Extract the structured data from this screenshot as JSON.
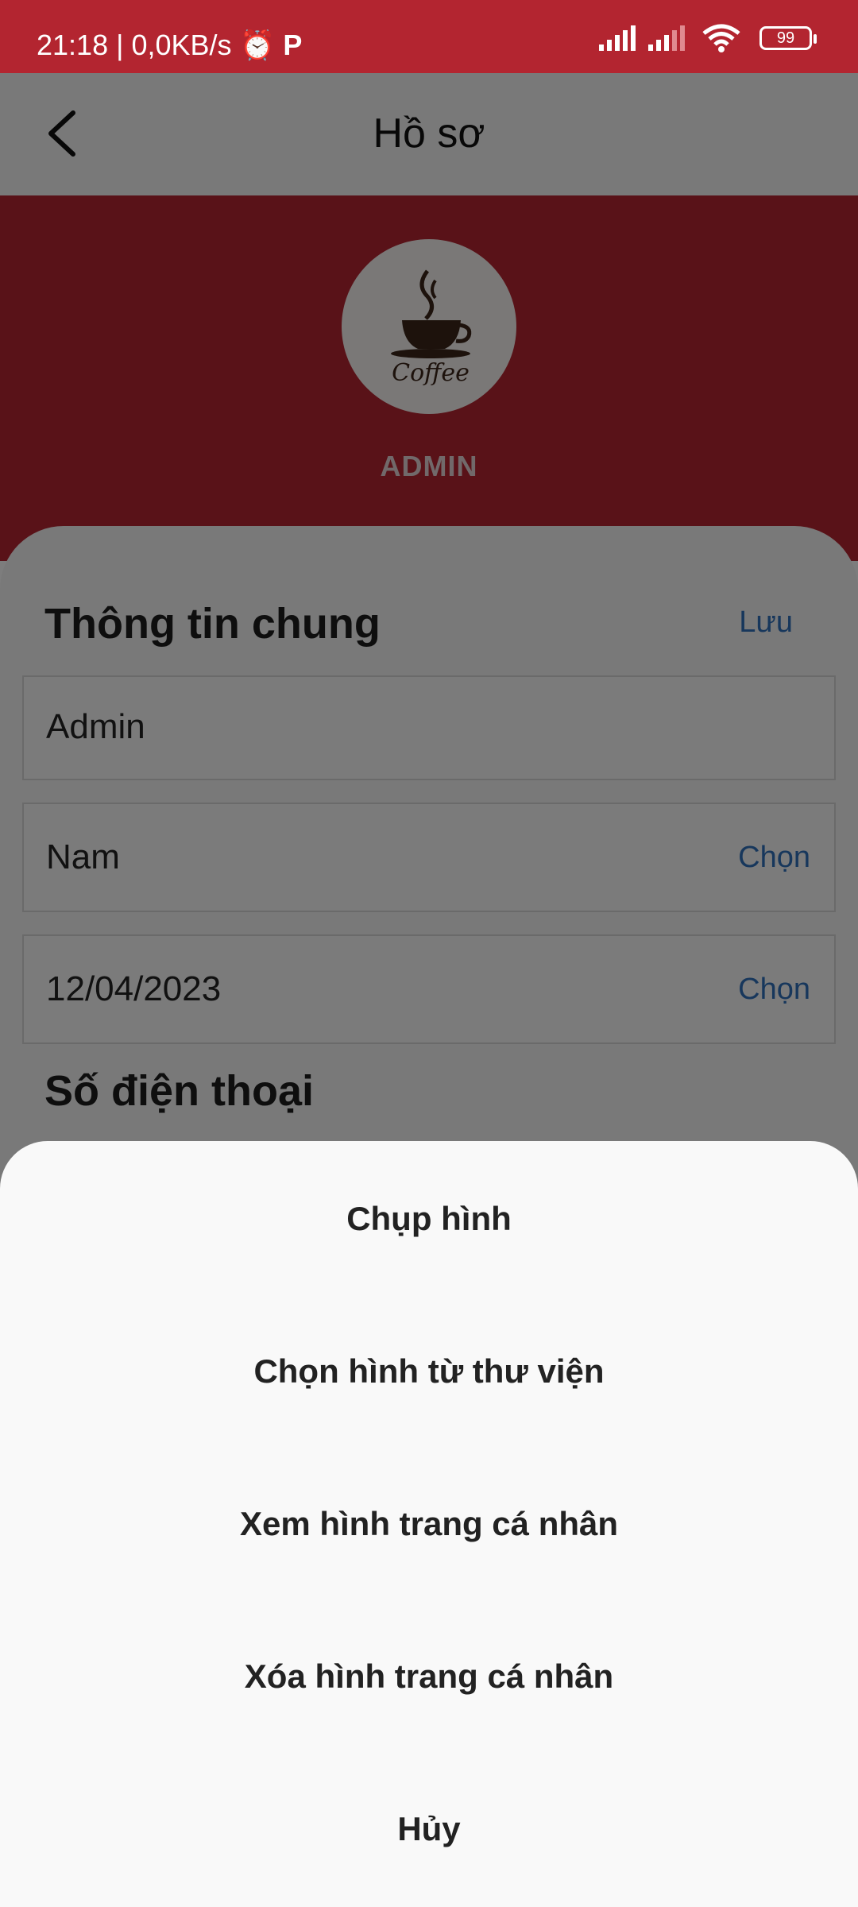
{
  "status_bar": {
    "time_info": "21:18 | 0,0KB/s",
    "battery": "99",
    "icons": [
      "alarm-icon",
      "p-icon",
      "signal-icon",
      "signal-icon",
      "wifi-icon",
      "battery-icon"
    ]
  },
  "header": {
    "title": "Hồ sơ",
    "back_icon": "chevron-left-icon"
  },
  "profile": {
    "avatar_text": "Coffee",
    "username": "ADMIN"
  },
  "general_info": {
    "title": "Thông tin chung",
    "save_label": "Lưu",
    "name_value": "Admin",
    "gender_value": "Nam",
    "gender_choose": "Chọn",
    "birthday_value": "12/04/2023",
    "birthday_choose": "Chọn"
  },
  "phone_section": {
    "title": "Số điện thoại"
  },
  "colors": {
    "brand_red": "#b32530",
    "link_blue": "#2f6fb8"
  },
  "action_sheet": {
    "items": [
      "Chụp hình",
      "Chọn hình từ thư viện",
      "Xem hình trang cá nhân",
      "Xóa hình trang cá nhân",
      "Hủy"
    ]
  }
}
